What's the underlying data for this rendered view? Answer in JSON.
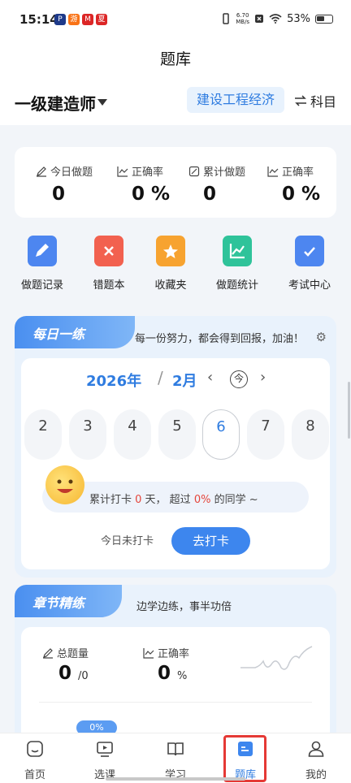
{
  "statusbar": {
    "time": "15:14",
    "net_speed": "6.70",
    "net_speed_unit": "MB/s",
    "battery": "53%",
    "app_icons": [
      "P",
      "游",
      "M",
      "夏"
    ],
    "app_colors": [
      "#1e3a8a",
      "#f97316",
      "#dc2626",
      "#dc2626"
    ]
  },
  "header": {
    "title": "题库"
  },
  "exam": {
    "name": "一级建造师",
    "subject": "建设工程经济",
    "switch_label": "科目"
  },
  "stats": [
    {
      "label": "今日做题",
      "value": "0",
      "icon": "edit-icon"
    },
    {
      "label": "正确率",
      "value": "0 %",
      "icon": "chart-icon"
    },
    {
      "label": "累计做题",
      "value": "0",
      "icon": "doc-edit-icon"
    },
    {
      "label": "正确率",
      "value": "0 %",
      "icon": "chart-icon"
    }
  ],
  "features": [
    {
      "label": "做题记录",
      "icon": "record-icon",
      "color": "#4d86f0"
    },
    {
      "label": "错题本",
      "icon": "wrong-book-icon",
      "color": "#f2614f"
    },
    {
      "label": "收藏夹",
      "icon": "star-folder-icon",
      "color": "#f7a330"
    },
    {
      "label": "做题统计",
      "icon": "stats-icon",
      "color": "#2fc39a"
    },
    {
      "label": "考试中心",
      "icon": "exam-center-icon",
      "color": "#4d86f0"
    }
  ],
  "daily": {
    "tab": "每日一练",
    "motto": "每一份努力，都会得到回报，加油！",
    "year": "2026年",
    "month": "2月",
    "today_label": "今",
    "days": [
      "2",
      "3",
      "4",
      "5",
      "6",
      "7",
      "8"
    ],
    "selected_day": "6",
    "checkin": {
      "prefix": "累计打卡 ",
      "days": "0",
      "mid": " 天，  超过 ",
      "percent": "0%",
      "suffix": " 的同学 ~"
    },
    "status": "今日未打卡",
    "button": "去打卡"
  },
  "chapter": {
    "tab": "章节精练",
    "motto": "边学边练，事半功倍",
    "total_label": "总题量",
    "total_value": "0",
    "total_unit": "/0",
    "accuracy_label": "正确率",
    "accuracy_value": "0",
    "accuracy_unit": "%",
    "progress_badge": "0%"
  },
  "nav": [
    {
      "label": "首页",
      "icon": "home-icon"
    },
    {
      "label": "选课",
      "icon": "video-icon"
    },
    {
      "label": "学习",
      "icon": "book-icon"
    },
    {
      "label": "题库",
      "icon": "question-bank-icon"
    },
    {
      "label": "我的",
      "icon": "profile-icon"
    }
  ],
  "colors": {
    "accent": "#2f7ce0",
    "highlight": "#e53935"
  }
}
